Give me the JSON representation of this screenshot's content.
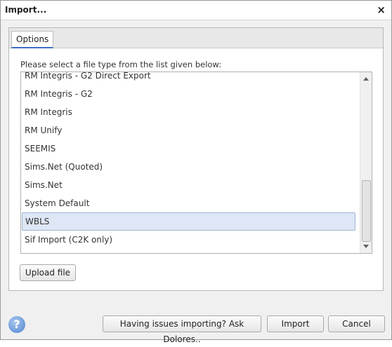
{
  "window": {
    "title": "Import...",
    "close_glyph": "×"
  },
  "tabs": [
    {
      "label": "Options",
      "active": true
    }
  ],
  "instruction": "Please select a file type from the list given below:",
  "file_types": [
    {
      "label": "RM Integris - G2 Direct Export",
      "selected": false
    },
    {
      "label": "RM Integris - G2",
      "selected": false
    },
    {
      "label": "RM Integris",
      "selected": false
    },
    {
      "label": "RM Unify",
      "selected": false
    },
    {
      "label": "SEEMIS",
      "selected": false
    },
    {
      "label": "Sims.Net (Quoted)",
      "selected": false
    },
    {
      "label": "Sims.Net",
      "selected": false
    },
    {
      "label": "System Default",
      "selected": false
    },
    {
      "label": "WBLS",
      "selected": true
    },
    {
      "label": "Sif Import (C2K only)",
      "selected": false
    }
  ],
  "buttons": {
    "upload": "Upload file",
    "ask": "Having issues importing? Ask Dolores..",
    "import": "Import",
    "cancel": "Cancel"
  },
  "help_glyph": "?",
  "colors": {
    "selected_bg": "#dde7f5",
    "tab_accent": "#3a6fc3",
    "help_icon": "#4e84cf"
  },
  "icons": [
    "close-icon",
    "scroll-up-icon",
    "scroll-down-icon",
    "help-icon"
  ]
}
